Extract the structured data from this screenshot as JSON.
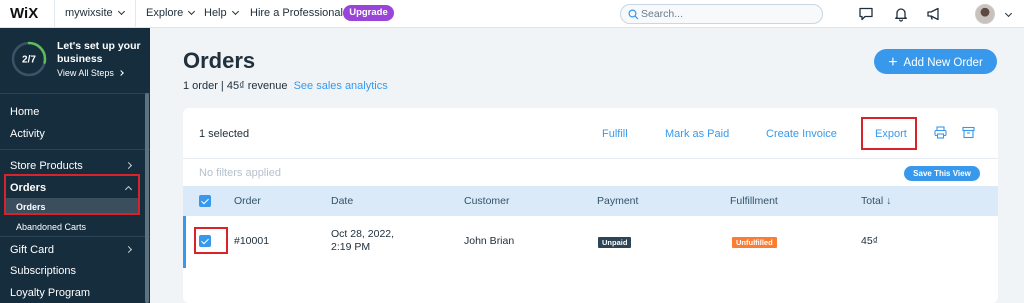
{
  "topbar": {
    "logo": "WiX",
    "site_name": "mywixsite",
    "nav": {
      "explore": "Explore",
      "help": "Help",
      "hire": "Hire a Professional"
    },
    "upgrade_label": "Upgrade",
    "search_placeholder": "Search...",
    "icons": [
      "chat-icon",
      "bell-icon",
      "megaphone-icon",
      "avatar"
    ]
  },
  "sidebar": {
    "setup": {
      "progress_text": "2/7",
      "progress_fraction": 0.2857,
      "title": "Let's set up your business",
      "link": "View All Steps"
    },
    "items": [
      {
        "label": "Home"
      },
      {
        "label": "Activity"
      },
      {
        "label": "Store Products"
      },
      {
        "label": "Orders"
      },
      {
        "label": "Orders",
        "sub": true,
        "selected": true
      },
      {
        "label": "Abandoned Carts",
        "sub": true
      },
      {
        "label": "Gift Card"
      },
      {
        "label": "Subscriptions"
      },
      {
        "label": "Loyalty Program"
      }
    ]
  },
  "main": {
    "title": "Orders",
    "summary": "1 order | 45₫ revenue",
    "analytics_link": "See sales analytics",
    "add_button": "Add New Order",
    "toolbar": {
      "selected": "1 selected",
      "fulfill": "Fulfill",
      "mark_paid": "Mark as Paid",
      "create_invoice": "Create Invoice",
      "export": "Export"
    },
    "filters_text": "No filters applied",
    "save_view": "Save This View",
    "columns": [
      "Order",
      "Date",
      "Customer",
      "Payment",
      "Fulfillment",
      "Total ↓"
    ],
    "rows": [
      {
        "order": "#10001",
        "date_line1": "Oct 28, 2022,",
        "date_line2": "2:19 PM",
        "customer": "John Brian",
        "payment": "Unpaid",
        "fulfillment": "Unfulfilled",
        "total": "45₫"
      }
    ]
  },
  "colors": {
    "sidebar_bg": "#162d3d",
    "accent_blue": "#3899ec",
    "upgrade_purple": "#9a45d8",
    "highlight_red": "#d8232a",
    "unfulfilled_orange": "#fb7d33",
    "unpaid_dark": "#2d4356"
  }
}
